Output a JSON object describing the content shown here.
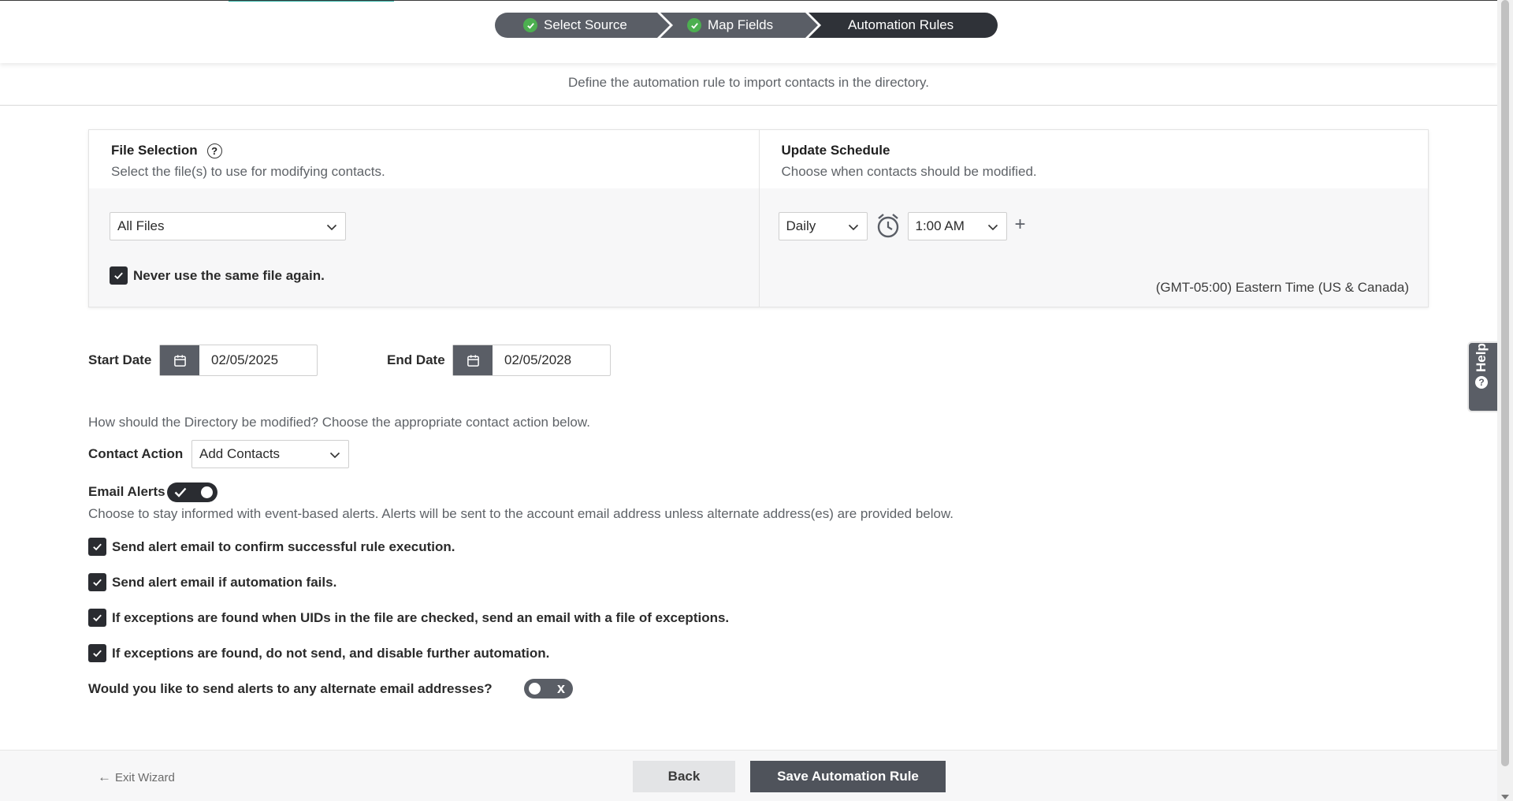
{
  "stepper": {
    "steps": [
      {
        "label": "Select Source",
        "status": "complete"
      },
      {
        "label": "Map Fields",
        "status": "complete"
      },
      {
        "label": "Automation Rules",
        "status": "current"
      }
    ]
  },
  "page": {
    "subtitle": "Define the automation rule to import contacts in the directory."
  },
  "file_selection": {
    "title": "File Selection",
    "description": "Select the file(s) to use for modifying contacts.",
    "help_icon": "?",
    "dropdown_value": "All Files",
    "never_reuse_label": "Never use the same file again.",
    "never_reuse_checked": true
  },
  "update_schedule": {
    "title": "Update Schedule",
    "description": "Choose when contacts should be modified.",
    "frequency_value": "Daily",
    "time_value": "1:00 AM",
    "add_label": "+",
    "timezone": "(GMT-05:00) Eastern Time (US & Canada)"
  },
  "dates": {
    "start_label": "Start Date",
    "start_value": "02/05/2025",
    "end_label": "End Date",
    "end_value": "02/05/2028"
  },
  "contact_action": {
    "prompt": "How should the Directory be modified? Choose the appropriate contact action below.",
    "label": "Contact Action",
    "value": "Add Contacts"
  },
  "email_alerts": {
    "label": "Email Alerts",
    "enabled": true,
    "description": "Choose to stay informed with event-based alerts. Alerts will be sent to the account email address unless alternate address(es) are provided below.",
    "options": [
      {
        "label": "Send alert email to confirm successful rule execution.",
        "checked": true
      },
      {
        "label": "Send alert email if automation fails.",
        "checked": true
      },
      {
        "label": "If exceptions are found when UIDs in the file are checked, send an email with a file of exceptions.",
        "checked": true
      },
      {
        "label": "If exceptions are found, do not send, and disable further automation.",
        "checked": true
      }
    ],
    "alternate_prompt": "Would you like to send alerts to any alternate email addresses?",
    "alternate_enabled": false,
    "alternate_off_mark": "x"
  },
  "help_tab": {
    "label": "Help",
    "icon_glyph": "?"
  },
  "footer": {
    "exit_label": "Exit Wizard",
    "back_label": "Back",
    "save_label": "Save Automation Rule"
  },
  "colors": {
    "accent_dark": "#2a2c31",
    "step_gray": "#5a5e66",
    "step_check": "#4caf50",
    "progress_teal": "#2bb3a7"
  }
}
